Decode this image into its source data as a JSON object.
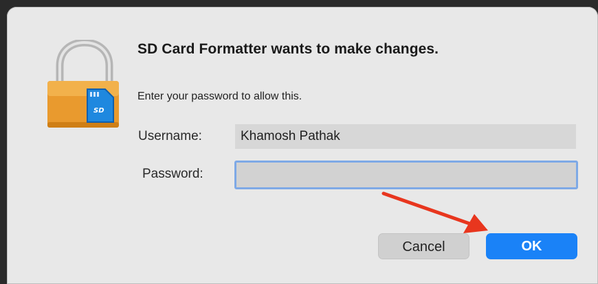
{
  "dialog": {
    "title": "SD Card Formatter wants to make changes.",
    "subtitle": "Enter your password to allow this."
  },
  "fields": {
    "username_label": "Username:",
    "username_value": "Khamosh Pathak",
    "password_label": "Password:",
    "password_value": ""
  },
  "buttons": {
    "cancel_label": "Cancel",
    "ok_label": "OK"
  },
  "icons": {
    "lock": "padlock-icon",
    "sd_card": "sd-card-icon",
    "annotation": "red-arrow-icon"
  },
  "colors": {
    "ok_button": "#1a82f7",
    "focus_ring": "#7ea9e6",
    "arrow": "#e8361e"
  }
}
